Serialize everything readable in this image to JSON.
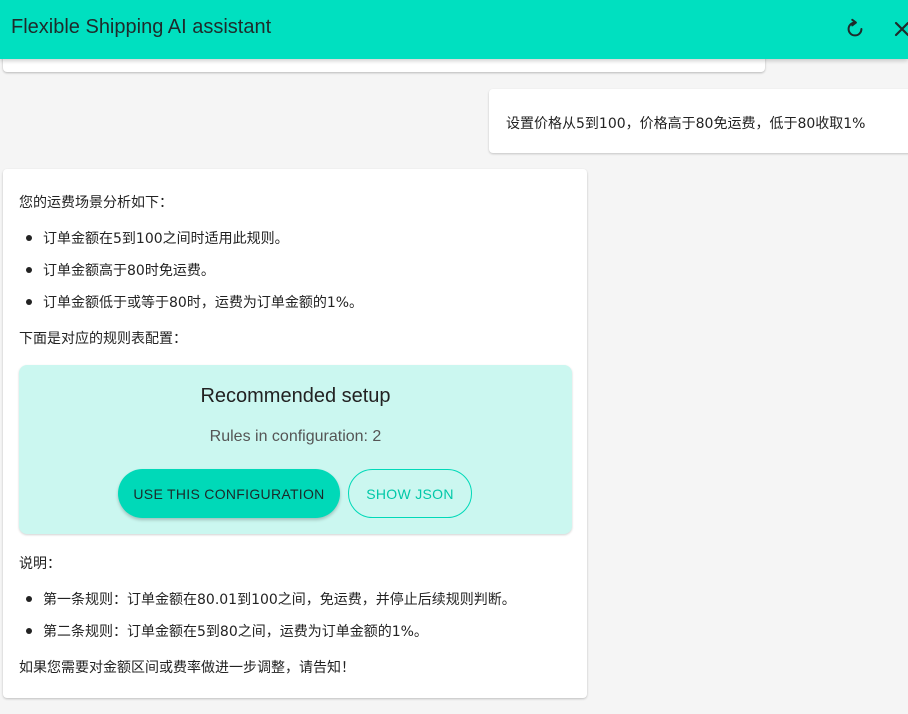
{
  "header": {
    "title": "Flexible Shipping AI assistant",
    "refresh_icon": "refresh-icon",
    "close_icon": "close-icon",
    "accent_color": "#00e0c0"
  },
  "user_message": {
    "text": "设置价格从5到100，价格高于80免运费，低于80收取1%"
  },
  "assistant_message": {
    "intro": "您的运费场景分析如下：",
    "analysis_items": [
      "订单金额在5到100之间时适用此规则。",
      "订单金额高于80时免运费。",
      "订单金额低于或等于80时，运费为订单金额的1%。"
    ],
    "config_lead": "下面是对应的规则表配置：",
    "setup": {
      "title": "Recommended setup",
      "rules_text": "Rules in configuration: 2",
      "use_button": "USE THIS CONFIGURATION",
      "json_button": "SHOW JSON",
      "background_color": "#cbf7f0"
    },
    "notes_heading": "说明：",
    "notes_items": [
      "第一条规则：订单金额在80.01到100之间，免运费，并停止后续规则判断。",
      "第二条规则：订单金额在5到80之间，运费为订单金额的1%。"
    ],
    "closing": "如果您需要对金额区间或费率做进一步调整，请告知！"
  }
}
